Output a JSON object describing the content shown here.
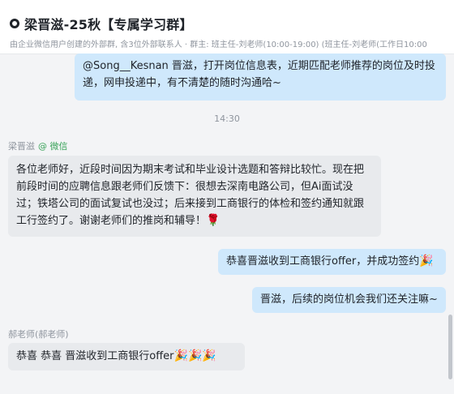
{
  "header": {
    "title": "梁晋滋-25秋【专属学习群】",
    "subtitle": "由企业微信用户创建的外部群, 含3位外部联系人 · 群主: 班主任-刘老师(10:00-19:00)  (班主任-刘老师(工作日10:00"
  },
  "messages": {
    "m1": {
      "text": "@Song__Kesnan 晋滋，打开岗位信息表，近期匹配老师推荐的岗位及时投递，网申投递中，有不清楚的随时沟通哈~"
    },
    "time1": "14:30",
    "sender1": {
      "name": "梁晋滋",
      "platform": "@ 微信"
    },
    "m2": {
      "text": "各位老师好，近段时间因为期末考试和毕业设计选题和答辩比较忙。现在把前段时间的应聘信息跟老师们反馈下：很想去深南电路公司，但Ai面试没过；铁塔公司的面试复试也没过；后来接到工商银行的体检和签约通知就跟工行签约了。谢谢老师们的推岗和辅导！",
      "emoji": "🌹"
    },
    "m3": {
      "text": "恭喜晋滋收到工商银行offer，并成功签约",
      "emoji": "🎉"
    },
    "m4": {
      "text": "晋滋，后续的岗位机会我们还关注嘛~"
    },
    "sender2": {
      "name": "郝老师(郝老师)"
    },
    "m5": {
      "text": "恭喜  恭喜   晋滋收到工商银行offer",
      "emoji": "🎉🎉🎉"
    }
  }
}
